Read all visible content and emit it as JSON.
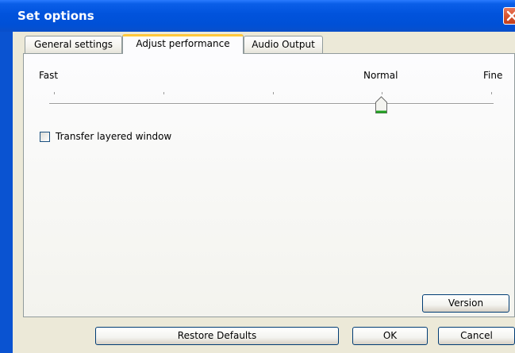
{
  "window": {
    "title": "Set options"
  },
  "tabs": [
    {
      "label": "General settings",
      "active": false
    },
    {
      "label": "Adjust performance",
      "active": true
    },
    {
      "label": "Audio Output",
      "active": false
    }
  ],
  "performance": {
    "slider": {
      "labels": {
        "left": "Fast",
        "middle": "Normal",
        "right": "Fine"
      },
      "value": "Normal",
      "tick_count": 5,
      "position_index": 3
    },
    "transfer_layered_window": {
      "label": "Transfer layered window",
      "checked": false
    }
  },
  "buttons": {
    "version": "Version",
    "restore_defaults": "Restore Defaults",
    "ok": "OK",
    "cancel": "Cancel"
  },
  "colors": {
    "title_bar": "#0153dc",
    "window_bg": "#ece9d8",
    "active_tab_accent": "#ffc83c",
    "close_button": "#d8552f",
    "thumb_accent": "#21a121"
  },
  "icons": {
    "close": "close-icon",
    "slider_thumb": "slider-thumb"
  }
}
